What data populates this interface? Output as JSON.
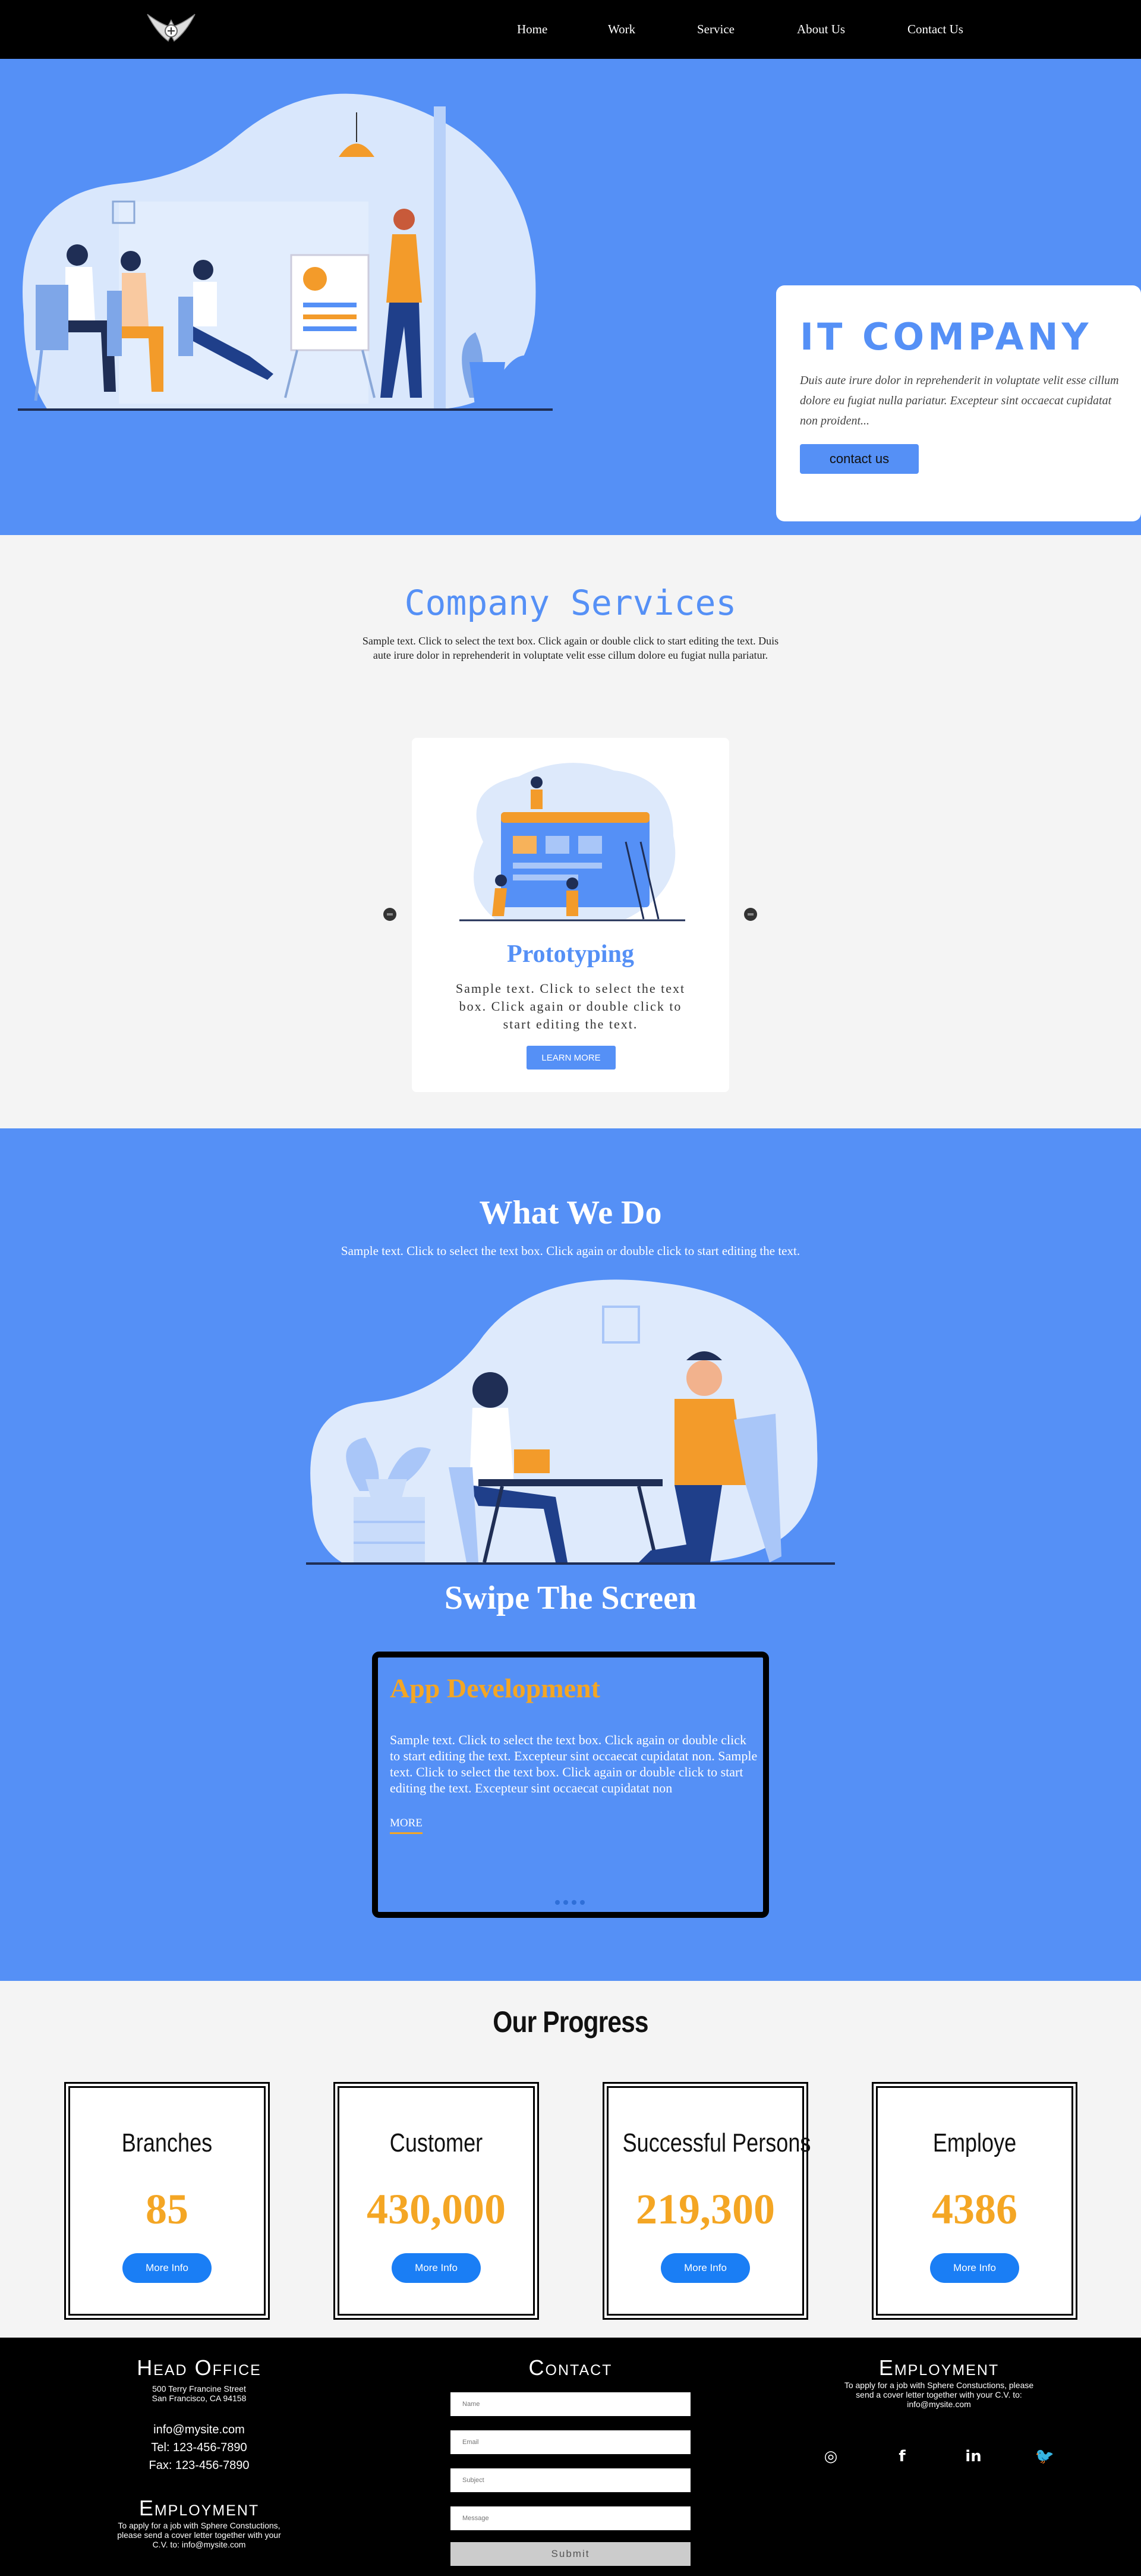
{
  "nav": {
    "items": [
      {
        "label": "Home"
      },
      {
        "label": "Work"
      },
      {
        "label": "Service"
      },
      {
        "label": "About Us"
      },
      {
        "label": "Contact Us"
      }
    ]
  },
  "hero": {
    "title": "IT COMPANY",
    "text": "Duis aute irure dolor in reprehenderit in voluptate velit esse cillum dolore eu fugiat nulla pariatur. Excepteur sint occaecat cupidatat non proident...",
    "button": "contact us"
  },
  "services": {
    "title": "Company Services",
    "text": "Sample text. Click to select the text box. Click again or double click to start editing the text. Duis aute irure dolor in reprehenderit in voluptate velit esse cillum dolore eu fugiat nulla pariatur.",
    "card": {
      "title": "Prototyping",
      "text": "Sample text. Click to select the text box. Click again or double click to start editing the text.",
      "button": "LEARN MORE"
    }
  },
  "whatwedo": {
    "title": "What We Do",
    "text": "Sample text. Click to select the text box. Click again or double click to start editing the text.",
    "swipe_title": "Swipe The Screen",
    "slide": {
      "title": "App Development",
      "text": "Sample text. Click to select the text box. Click again or double click to start editing the text. Excepteur sint occaecat cupidatat non. Sample text. Click to select the text box. Click again or double click to start editing the text. Excepteur sint occaecat cupidatat non",
      "link": "MORE"
    }
  },
  "progress": {
    "title": "Our Progress",
    "cards": [
      {
        "name": "Branches",
        "value": "85",
        "button": "More Info"
      },
      {
        "name": "Customer",
        "value": "430,000",
        "button": "More Info"
      },
      {
        "name": "Successful Persons",
        "value": "219,300",
        "button": "More Info"
      },
      {
        "name": "Employe",
        "value": "4386",
        "button": "More Info"
      }
    ]
  },
  "footer": {
    "head_office": {
      "title": "Head Office",
      "address1": "500 Terry Francine Street",
      "address2": "San Francisco, CA 94158",
      "email": "info@mysite.com",
      "tel": "Tel: 123-456-7890",
      "fax": "Fax: 123-456-7890"
    },
    "employment_left": {
      "title": "Employment",
      "text": "To apply for a job with Sphere Constuctions, please send a cover letter together with your C.V. to: info@mysite.com"
    },
    "contact": {
      "title": "Contact",
      "name_placeholder": "Name",
      "email_placeholder": "Email",
      "subject_placeholder": "Subject",
      "message_placeholder": "Message",
      "submit": "Submit"
    },
    "employment_right": {
      "title": "Employment",
      "text": "To apply for a job with Sphere Constuctions, please send a cover letter together with your C.V. to: info@mysite.com"
    },
    "socials": [
      {
        "icon": "instagram-icon",
        "glyph": "◎"
      },
      {
        "icon": "facebook-icon",
        "glyph": "f"
      },
      {
        "icon": "linkedin-icon",
        "glyph": "in"
      },
      {
        "icon": "twitter-icon",
        "glyph": "🐦"
      }
    ]
  },
  "colors": {
    "brand_blue": "#5590f6",
    "accent_orange": "#f4a624",
    "button_blue": "#1a7ef5"
  }
}
